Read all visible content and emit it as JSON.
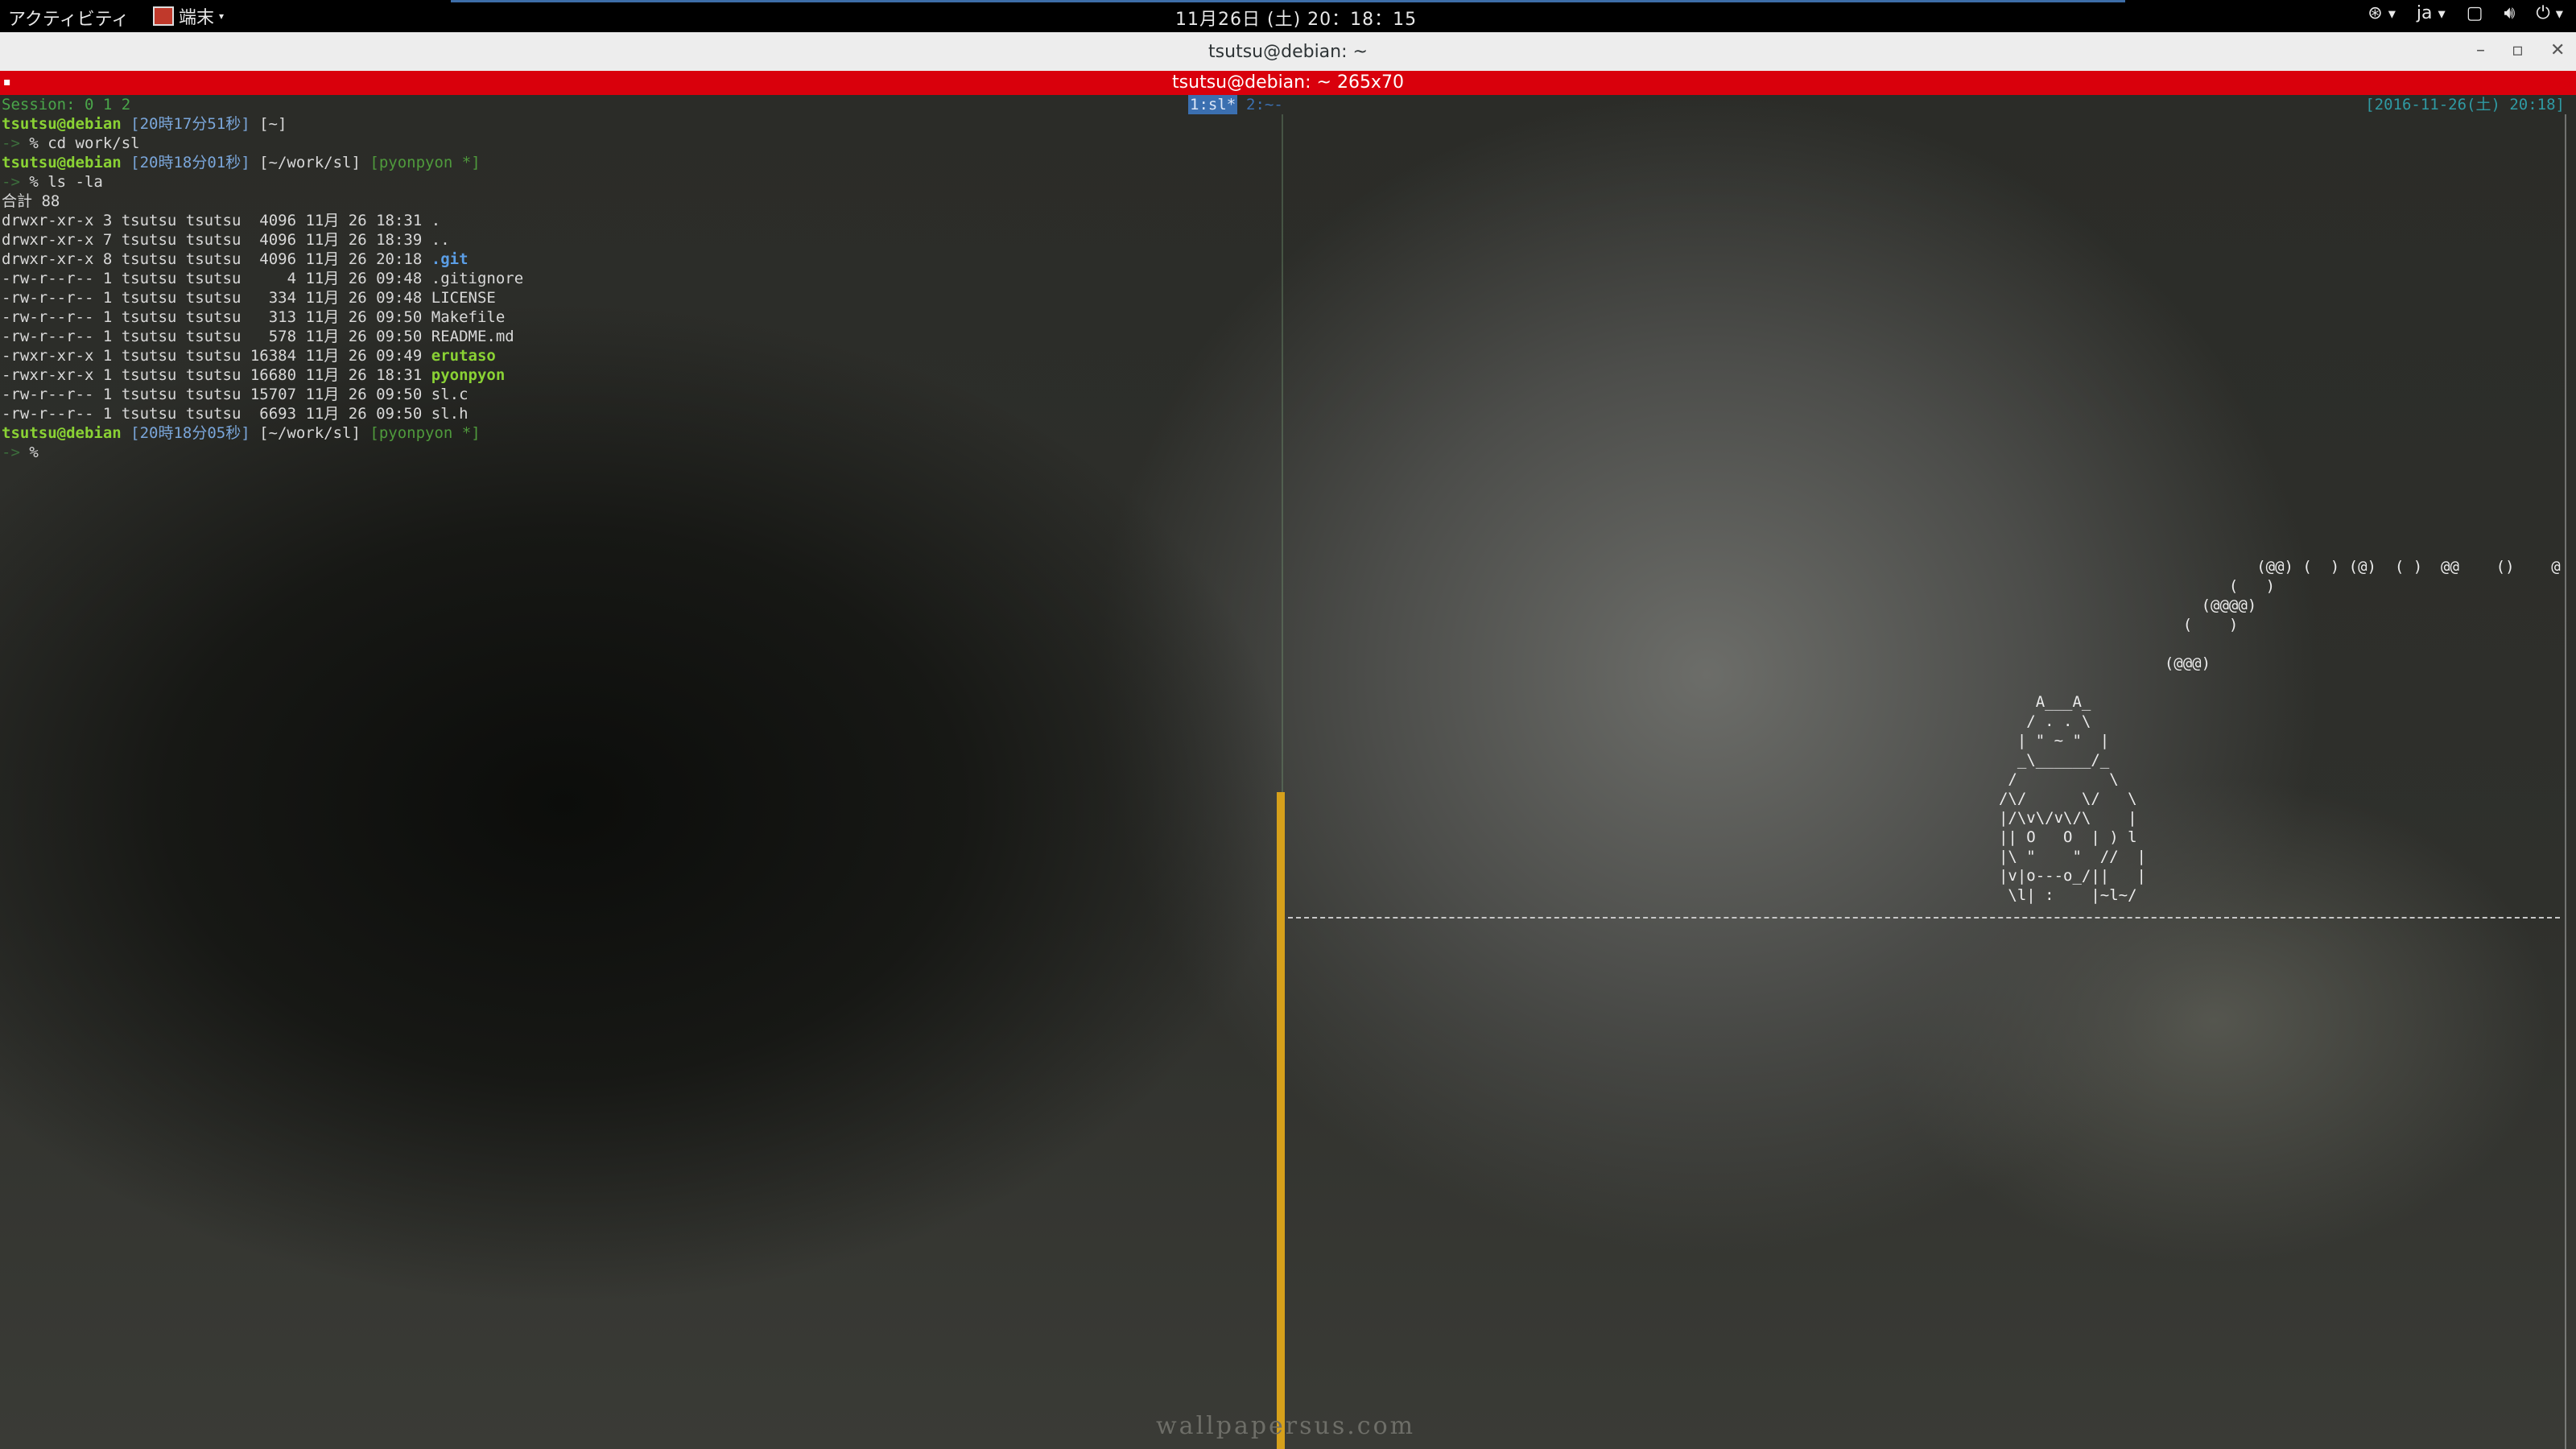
{
  "topbar": {
    "activities": "アクティビティ",
    "app_menu": "端末",
    "clock": "11月26日 (土) 20：18：15",
    "input_method": "ja",
    "tray_icons": [
      "accessibility-icon",
      "window-icon",
      "volume-icon",
      "power-icon"
    ]
  },
  "window": {
    "title": "tsutsu@debian: ~",
    "inner_title": "tsutsu@debian: ~ 265x70"
  },
  "tmux": {
    "session": "Session: 0 1 2",
    "window1": "1:sl*",
    "window2": "2:~-",
    "date": "[2016-11-26(土) 20:18]"
  },
  "terminal": {
    "lines": [
      [
        {
          "t": "tsutsu@debian",
          "c": "c-green"
        },
        {
          "t": " [20時17分51秒] ",
          "c": "c-blue"
        },
        {
          "t": "[~]",
          "c": "c-white"
        }
      ],
      [
        {
          "t": "-> ",
          "c": "c-dim"
        },
        {
          "t": "% cd work/sl",
          "c": "c-white"
        }
      ],
      [
        {
          "t": "tsutsu@debian",
          "c": "c-green"
        },
        {
          "t": " [20時18分01秒] ",
          "c": "c-blue"
        },
        {
          "t": "[~/work/sl] ",
          "c": "c-white"
        },
        {
          "t": "[pyonpyon *]",
          "c": "c-branch"
        }
      ],
      [
        {
          "t": "-> ",
          "c": "c-dim"
        },
        {
          "t": "% ls -la",
          "c": "c-white"
        }
      ],
      [
        {
          "t": "合計 88",
          "c": "c-white"
        }
      ],
      [
        {
          "t": "drwxr-xr-x 3 tsutsu tsutsu  4096 11月 26 18:31 .",
          "c": "c-white"
        }
      ],
      [
        {
          "t": "drwxr-xr-x 7 tsutsu tsutsu  4096 11月 26 18:39 ..",
          "c": "c-white"
        }
      ],
      [
        {
          "t": "drwxr-xr-x 8 tsutsu tsutsu  4096 11月 26 20:18 ",
          "c": "c-white"
        },
        {
          "t": ".git",
          "c": "c-git"
        }
      ],
      [
        {
          "t": "-rw-r--r-- 1 tsutsu tsutsu     4 11月 26 09:48 .gitignore",
          "c": "c-white"
        }
      ],
      [
        {
          "t": "-rw-r--r-- 1 tsutsu tsutsu   334 11月 26 09:48 LICENSE",
          "c": "c-white"
        }
      ],
      [
        {
          "t": "-rw-r--r-- 1 tsutsu tsutsu   313 11月 26 09:50 Makefile",
          "c": "c-white"
        }
      ],
      [
        {
          "t": "-rw-r--r-- 1 tsutsu tsutsu   578 11月 26 09:50 README.md",
          "c": "c-white"
        }
      ],
      [
        {
          "t": "-rwxr-xr-x 1 tsutsu tsutsu 16384 11月 26 09:49 ",
          "c": "c-white"
        },
        {
          "t": "erutaso",
          "c": "c-bgreen"
        }
      ],
      [
        {
          "t": "-rwxr-xr-x 1 tsutsu tsutsu 16680 11月 26 18:31 ",
          "c": "c-white"
        },
        {
          "t": "pyonpyon",
          "c": "c-bgreen"
        }
      ],
      [
        {
          "t": "-rw-r--r-- 1 tsutsu tsutsu 15707 11月 26 09:50 sl.c",
          "c": "c-white"
        }
      ],
      [
        {
          "t": "-rw-r--r-- 1 tsutsu tsutsu  6693 11月 26 09:50 sl.h",
          "c": "c-white"
        }
      ],
      [
        {
          "t": "tsutsu@debian",
          "c": "c-green"
        },
        {
          "t": " [20時18分05秒] ",
          "c": "c-blue"
        },
        {
          "t": "[~/work/sl] ",
          "c": "c-white"
        },
        {
          "t": "[pyonpyon *]",
          "c": "c-branch"
        }
      ],
      [
        {
          "t": "-> ",
          "c": "c-dim"
        },
        {
          "t": "%",
          "c": "c-white"
        }
      ]
    ],
    "sl_art": "                                     (@@) (  ) (@)  ( )  @@    ()    @     O\n                                  (   )\n                               (@@@@)\n                             (    )\n\n                           (@@@)\n\n             A___A_\n            / . . \\\n           | \" ~ \"  |\n           _\\______/_\n          /          \\\n         /\\/      \\/   \\\n         |/\\v\\/v\\/\\    |\n         || O   O  | ) l\n         |\\ \"    \"  //  |\n         |v|o---o_/||   |\n          \\l| :    |~l~/",
    "watermark": "wallpapersus.com"
  }
}
